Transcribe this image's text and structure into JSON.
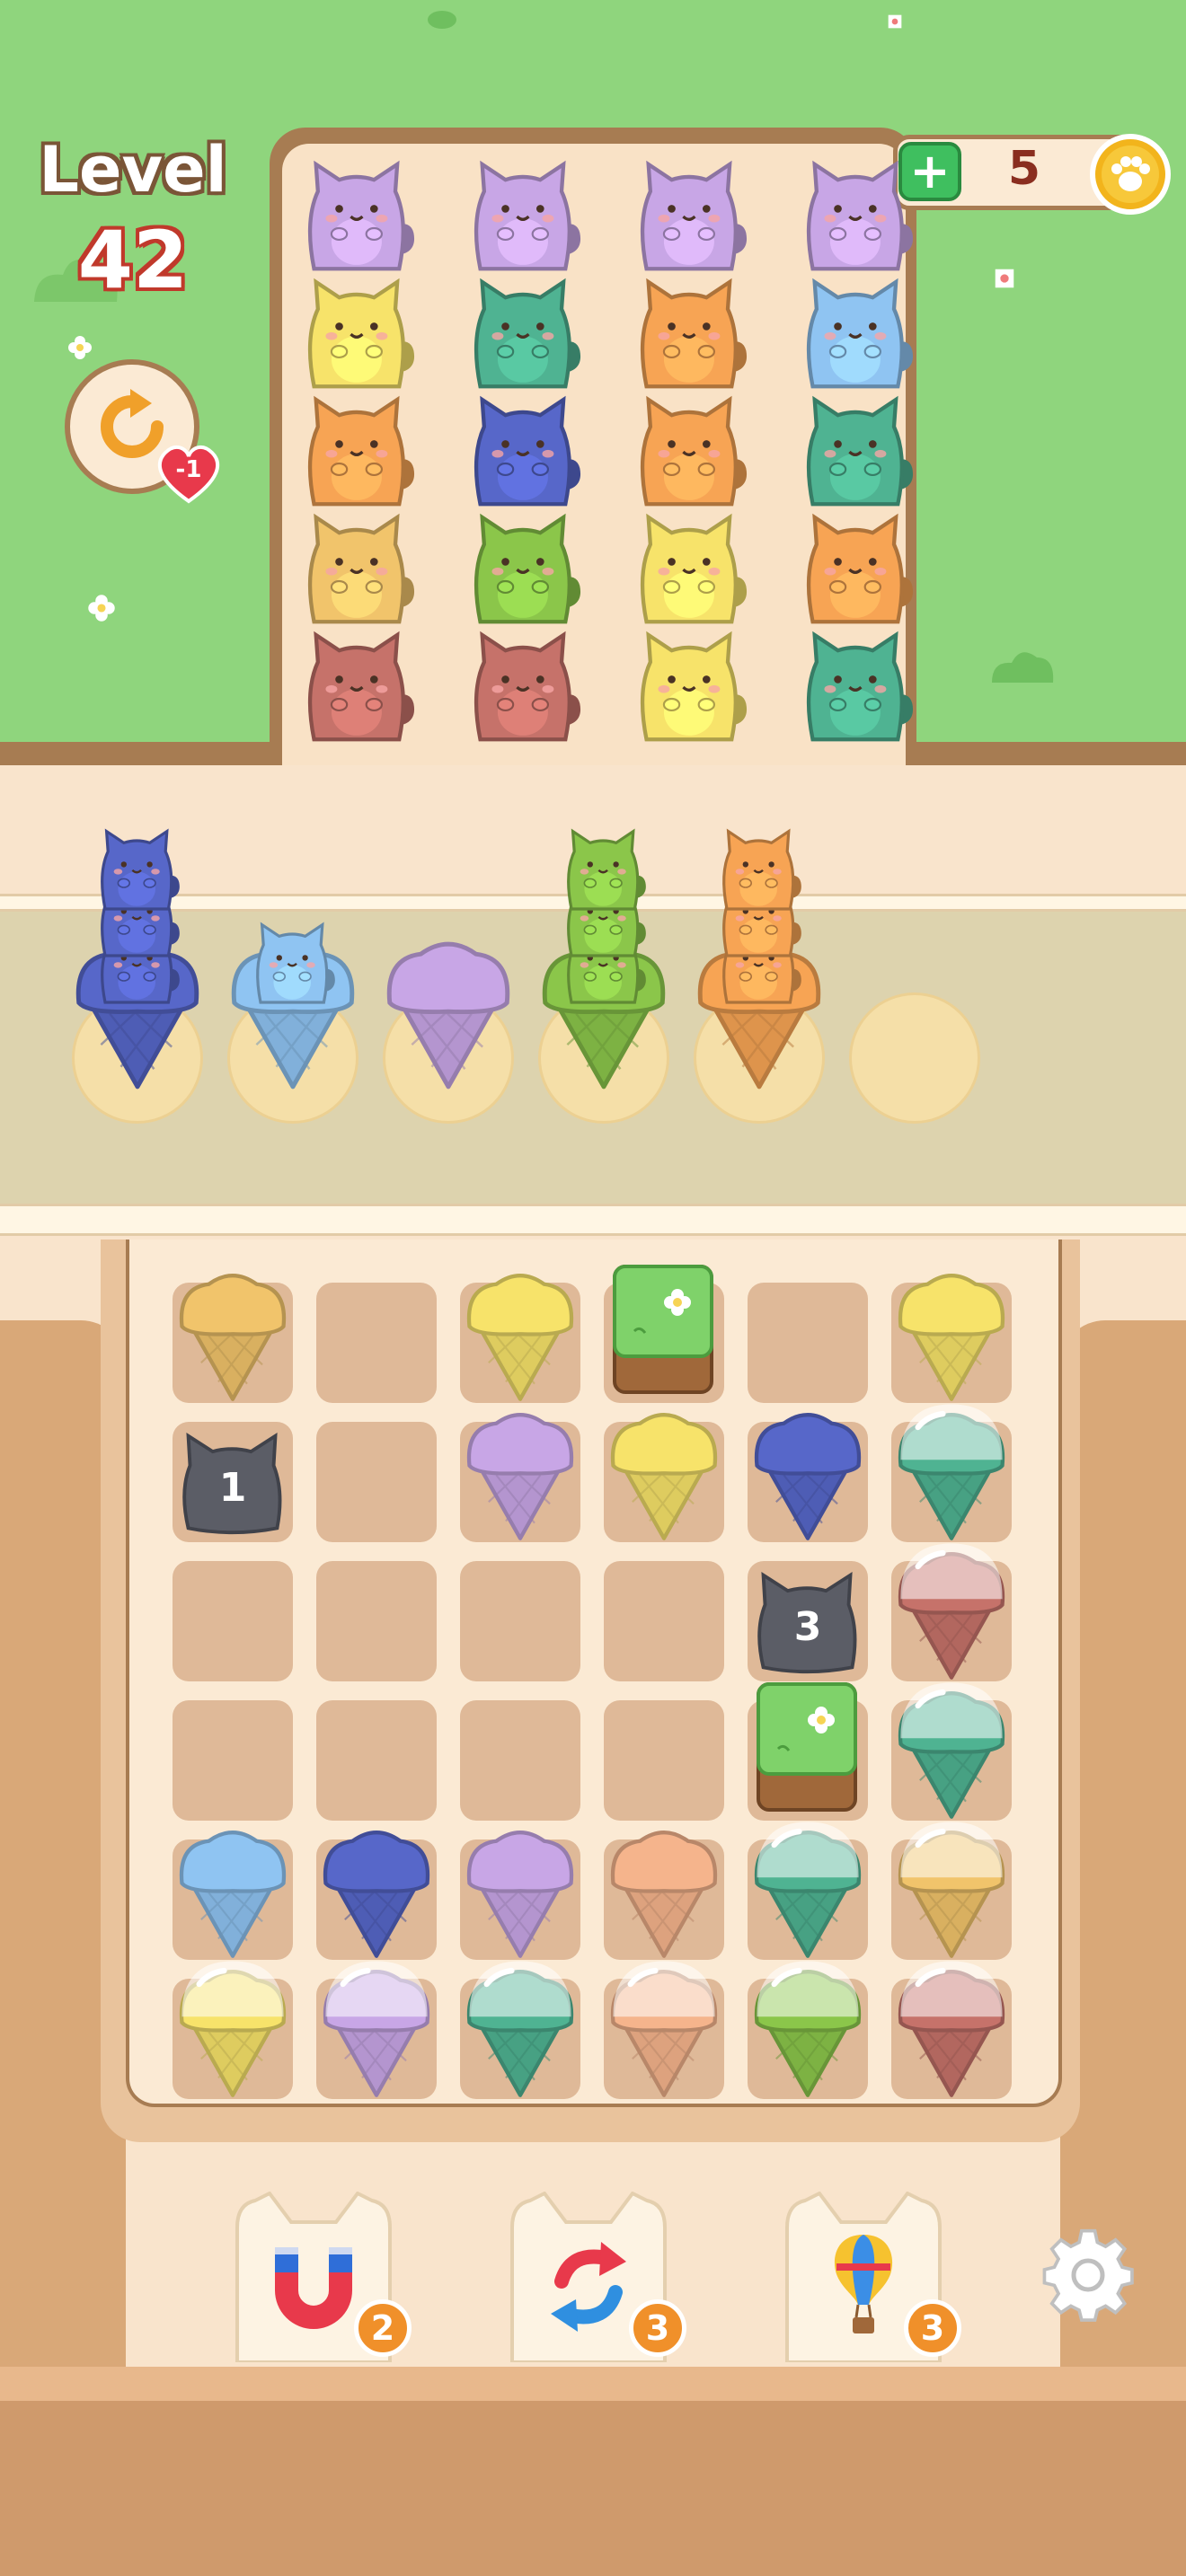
{
  "hud": {
    "level_label": "Level",
    "level_number": "42",
    "undo_cost": "-1",
    "coins": "5"
  },
  "colors": {
    "purple": "#c8a6e6",
    "yellow": "#f7e36a",
    "orange": "#f7a454",
    "teal": "#4fb392",
    "lightblue": "#8fc4f2",
    "navy": "#5767c9",
    "green": "#8bc64a",
    "brown": "#c6726a",
    "gold": "#f1c46b",
    "peach": "#f5b48c"
  },
  "cat_grid": {
    "columns": 4,
    "rows": [
      [
        "purple",
        "purple",
        "purple",
        "purple"
      ],
      [
        "yellow",
        "teal",
        "orange",
        "lightblue"
      ],
      [
        "orange",
        "navy",
        "orange",
        "teal"
      ],
      [
        "gold",
        "green",
        "yellow",
        "orange"
      ],
      [
        "brown",
        "brown",
        "yellow",
        "teal"
      ]
    ]
  },
  "tray": {
    "slots": [
      {
        "cone": "navy",
        "cats": 3
      },
      {
        "cone": "lightblue",
        "cats": 1
      },
      {
        "cone": "purple",
        "cats": 0
      },
      {
        "cone": "green",
        "cats": 3
      },
      {
        "cone": "orange",
        "cats": 3
      },
      {
        "cone": null,
        "cats": 0
      }
    ]
  },
  "cone_grid": {
    "rows": [
      [
        {
          "t": "cone",
          "c": "gold"
        },
        {
          "t": "empty"
        },
        {
          "t": "cone",
          "c": "yellow"
        },
        {
          "t": "grass"
        },
        {
          "t": "empty"
        },
        {
          "t": "cone",
          "c": "yellow"
        }
      ],
      [
        {
          "t": "lock",
          "n": "1"
        },
        {
          "t": "empty"
        },
        {
          "t": "cone",
          "c": "purple"
        },
        {
          "t": "cone",
          "c": "yellow"
        },
        {
          "t": "cone",
          "c": "navy"
        },
        {
          "t": "dome",
          "c": "teal"
        }
      ],
      [
        {
          "t": "empty"
        },
        {
          "t": "empty"
        },
        {
          "t": "empty"
        },
        {
          "t": "empty"
        },
        {
          "t": "lock",
          "n": "3"
        },
        {
          "t": "dome",
          "c": "brown"
        }
      ],
      [
        {
          "t": "empty"
        },
        {
          "t": "empty"
        },
        {
          "t": "empty"
        },
        {
          "t": "empty"
        },
        {
          "t": "grass"
        },
        {
          "t": "dome",
          "c": "teal"
        }
      ],
      [
        {
          "t": "cone",
          "c": "lightblue"
        },
        {
          "t": "cone",
          "c": "navy"
        },
        {
          "t": "cone",
          "c": "purple"
        },
        {
          "t": "cone",
          "c": "peach"
        },
        {
          "t": "dome",
          "c": "teal"
        },
        {
          "t": "dome",
          "c": "gold"
        }
      ],
      [
        {
          "t": "dome",
          "c": "yellow"
        },
        {
          "t": "dome",
          "c": "purple"
        },
        {
          "t": "dome",
          "c": "teal"
        },
        {
          "t": "dome",
          "c": "peach"
        },
        {
          "t": "dome",
          "c": "green"
        },
        {
          "t": "dome",
          "c": "brown"
        }
      ]
    ]
  },
  "tools": [
    {
      "name": "magnet",
      "count": "2"
    },
    {
      "name": "shuffle",
      "count": "3"
    },
    {
      "name": "balloon",
      "count": "3"
    }
  ],
  "icons": {
    "undo": "undo-icon",
    "settings": "gear-icon",
    "coin": "paw-coin-icon",
    "add": "plus-icon"
  }
}
